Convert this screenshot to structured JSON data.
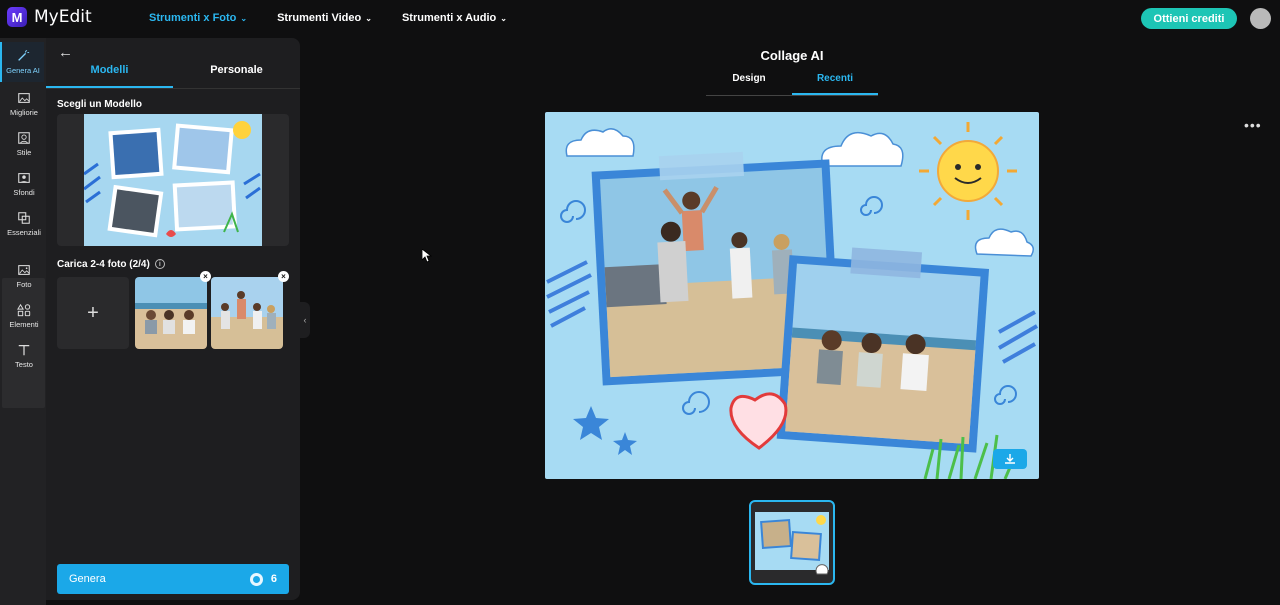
{
  "brand": {
    "name": "MyEdit",
    "logo_letter": "M"
  },
  "nav": {
    "items": [
      {
        "label": "Strumenti x Foto",
        "active": true
      },
      {
        "label": "Strumenti Video",
        "active": false
      },
      {
        "label": "Strumenti x Audio",
        "active": false
      }
    ]
  },
  "header": {
    "credits_label": "Ottieni crediti"
  },
  "toolrail": {
    "items": [
      {
        "label": "Genera AI",
        "icon": "magic-wand-icon",
        "active": true
      },
      {
        "label": "Migliorie",
        "icon": "enhance-icon",
        "active": false
      },
      {
        "label": "Stile",
        "icon": "style-icon",
        "active": false
      },
      {
        "label": "Sfondi",
        "icon": "background-icon",
        "active": false
      },
      {
        "label": "Essenziali",
        "icon": "crop-icon",
        "active": false
      },
      {
        "label": "Foto",
        "icon": "photo-icon",
        "active": false
      },
      {
        "label": "Elementi",
        "icon": "elements-icon",
        "active": false
      },
      {
        "label": "Testo",
        "icon": "text-icon",
        "active": false
      }
    ]
  },
  "panel": {
    "tabs": [
      {
        "label": "Modelli",
        "active": true
      },
      {
        "label": "Personale",
        "active": false
      }
    ],
    "choose_model_title": "Scegli un Modello",
    "upload_title": "Carica 2-4 foto (2/4)",
    "generate_label": "Genera",
    "generate_cost": "6"
  },
  "main": {
    "title": "Collage AI",
    "tabs": [
      {
        "label": "Design",
        "active": false
      },
      {
        "label": "Recenti",
        "active": true
      }
    ]
  },
  "colors": {
    "accent": "#2bb7f0",
    "credits": "#1dc5b5",
    "generate": "#1ba8e8",
    "collage_bg": "#a7dbf3"
  }
}
